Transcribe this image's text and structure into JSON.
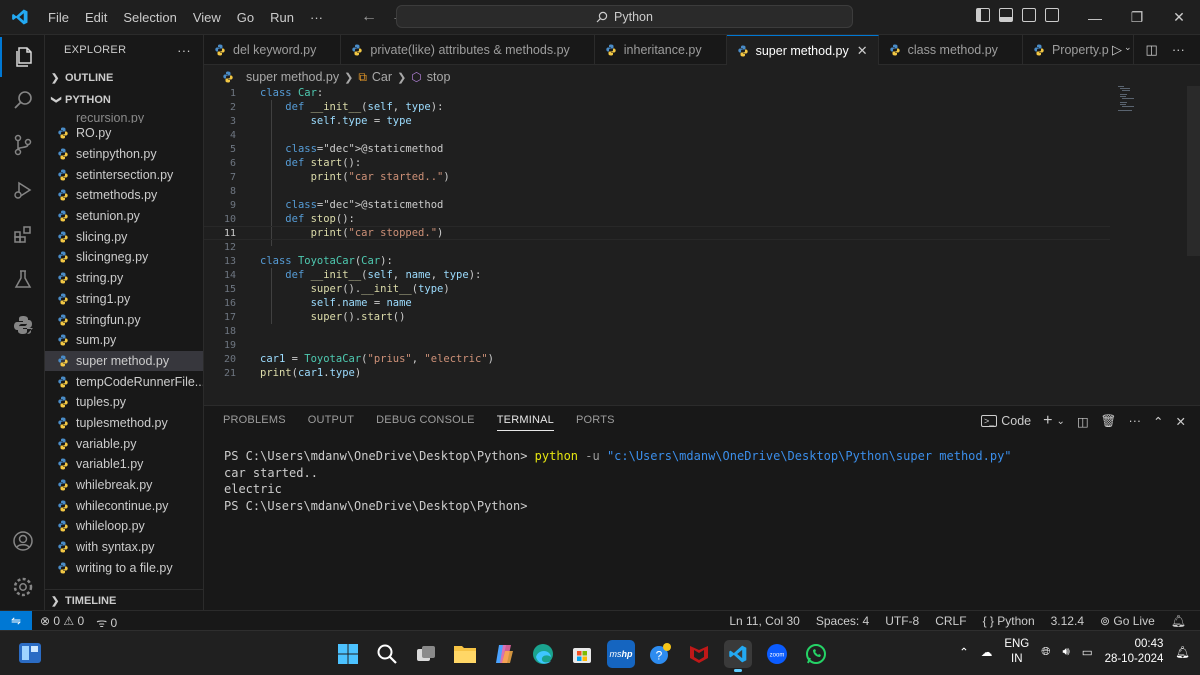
{
  "menu": [
    "File",
    "Edit",
    "Selection",
    "View",
    "Go",
    "Run",
    "···"
  ],
  "search": {
    "label": "Python"
  },
  "sidebar": {
    "title": "EXPLORER",
    "more": "···",
    "outline": "OUTLINE",
    "folder": "PYTHON",
    "partial_file": "recursion.py",
    "files": [
      "RO.py",
      "setinpython.py",
      "setintersection.py",
      "setmethods.py",
      "setunion.py",
      "slicing.py",
      "slicingneg.py",
      "string.py",
      "string1.py",
      "stringfun.py",
      "sum.py",
      "super method.py",
      "tempCodeRunnerFile....",
      "tuples.py",
      "tuplesmethod.py",
      "variable.py",
      "variable1.py",
      "whilebreak.py",
      "whilecontinue.py",
      "whileloop.py",
      "with syntax.py",
      "writing to a file.py"
    ],
    "active_file": "super method.py",
    "timeline": "TIMELINE"
  },
  "tabs": [
    {
      "label": "del keyword.py"
    },
    {
      "label": "private(like) attributes & methods.py"
    },
    {
      "label": "inheritance.py"
    },
    {
      "label": "super method.py",
      "active": true
    },
    {
      "label": "class method.py"
    },
    {
      "label": "Property.p"
    }
  ],
  "breadcrumb": {
    "file": "super method.py",
    "class": "Car",
    "method": "stop"
  },
  "editor": {
    "current_line": 11,
    "lines": [
      {
        "n": "1",
        "text": "class Car:"
      },
      {
        "n": "2",
        "text": "    def __init__(self, type):"
      },
      {
        "n": "3",
        "text": "        self.type = type"
      },
      {
        "n": "4",
        "text": ""
      },
      {
        "n": "5",
        "text": "    @staticmethod"
      },
      {
        "n": "6",
        "text": "    def start():"
      },
      {
        "n": "7",
        "text": "        print(\"car started..\")"
      },
      {
        "n": "8",
        "text": ""
      },
      {
        "n": "9",
        "text": "    @staticmethod"
      },
      {
        "n": "10",
        "text": "    def stop():"
      },
      {
        "n": "11",
        "text": "        print(\"car stopped.\")"
      },
      {
        "n": "12",
        "text": ""
      },
      {
        "n": "13",
        "text": "class ToyotaCar(Car):"
      },
      {
        "n": "14",
        "text": "    def __init__(self, name, type):"
      },
      {
        "n": "15",
        "text": "        super().__init__(type)"
      },
      {
        "n": "16",
        "text": "        self.name = name"
      },
      {
        "n": "17",
        "text": "        super().start()"
      },
      {
        "n": "18",
        "text": ""
      },
      {
        "n": "19",
        "text": ""
      },
      {
        "n": "20",
        "text": "car1 = ToyotaCar(\"prius\", \"electric\")"
      },
      {
        "n": "21",
        "text": "print(car1.type)"
      }
    ]
  },
  "panel": {
    "tabs": [
      "PROBLEMS",
      "OUTPUT",
      "DEBUG CONSOLE",
      "TERMINAL",
      "PORTS"
    ],
    "active_tab": "TERMINAL",
    "shell_label": "Code",
    "terminal": {
      "prompt1": "PS C:\\Users\\mdanw\\OneDrive\\Desktop\\Python> ",
      "cmd": "python",
      "flag": " -u ",
      "path": "\"c:\\Users\\mdanw\\OneDrive\\Desktop\\Python\\super method.py\"",
      "out1": "car started..",
      "out2": "electric",
      "prompt2": "PS C:\\Users\\mdanw\\OneDrive\\Desktop\\Python>"
    }
  },
  "statusbar": {
    "errors": "0",
    "warnings": "0",
    "ports": "0",
    "position": "Ln 11, Col 30",
    "spaces": "Spaces: 4",
    "encoding": "UTF-8",
    "eol": "CRLF",
    "language": "Python",
    "version": "3.12.4",
    "golive": "Go Live"
  },
  "taskbar": {
    "lang1": "ENG",
    "lang2": "IN",
    "time": "00:43",
    "date": "28-10-2024",
    "apps": [
      "windows-start",
      "search",
      "task-view",
      "file-explorer",
      "copilot",
      "edge",
      "store",
      "mshp",
      "help",
      "mcafee",
      "vscode",
      "zoom",
      "whatsapp"
    ]
  },
  "colors": {
    "accent": "#0078d4",
    "keyword": "#569cd6",
    "class": "#4ec9b0",
    "function": "#dcdcaa",
    "string": "#ce9178",
    "param": "#9cdcfe"
  }
}
